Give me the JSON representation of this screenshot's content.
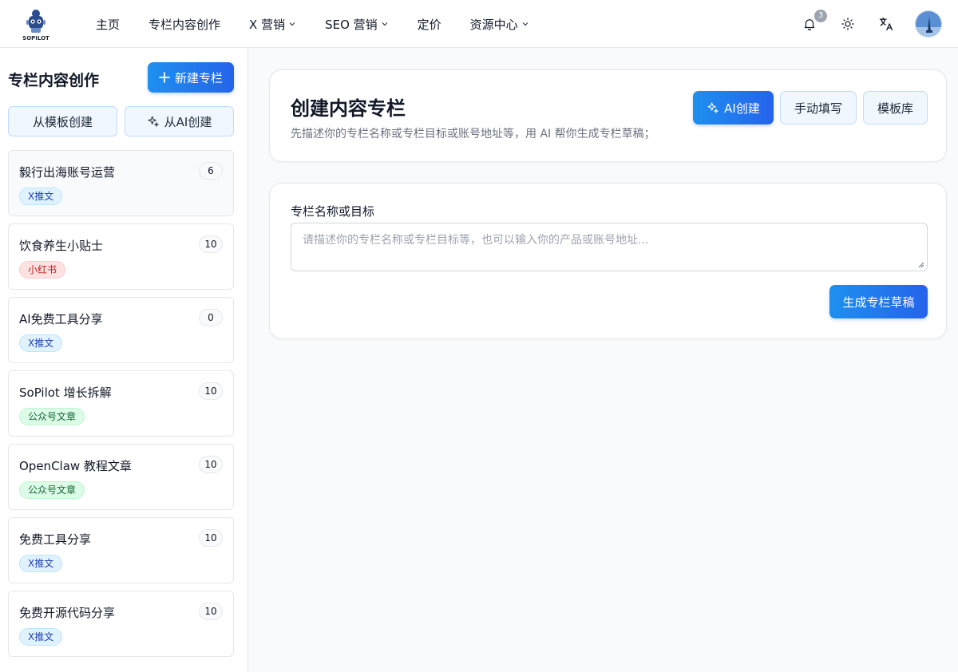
{
  "header": {
    "logo_text": "SOPILOT",
    "nav": [
      {
        "label": "主页"
      },
      {
        "label": "专栏内容创作"
      },
      {
        "label": "X 营销"
      },
      {
        "label": "SEO 营销"
      },
      {
        "label": "定价"
      },
      {
        "label": "资源中心"
      }
    ],
    "notification_count": "3",
    "icons": [
      "bell-icon",
      "sun-icon",
      "translate-icon"
    ]
  },
  "sidebar": {
    "title": "专栏内容创作",
    "new_button": "新建专栏",
    "template_button": "从模板创建",
    "ai_button": "从AI创建",
    "columns": [
      {
        "name": "毅行出海账号运营",
        "count": "6",
        "tag": "X推文"
      },
      {
        "name": "饮食养生小贴士",
        "count": "10",
        "tag": "小红书"
      },
      {
        "name": "AI免费工具分享",
        "count": "0",
        "tag": "X推文"
      },
      {
        "name": "SoPilot 增长拆解",
        "count": "10",
        "tag": "公众号文章"
      },
      {
        "name": "OpenClaw 教程文章",
        "count": "10",
        "tag": "公众号文章"
      },
      {
        "name": "免费工具分享",
        "count": "10",
        "tag": "X推文"
      },
      {
        "name": "免费开源代码分享",
        "count": "10",
        "tag": "X推文"
      }
    ]
  },
  "main": {
    "title": "创建内容专栏",
    "subtitle": "先描述你的专栏名称或专栏目标或账号地址等，用 AI 帮你生成专栏草稿；",
    "ai_create_button": "AI创建",
    "manual_button": "手动填写",
    "template_button": "模板库",
    "field_label": "专栏名称或目标",
    "field_placeholder": "请描述你的专栏名称或专栏目标等，也可以输入你的产品或账号地址...",
    "generate_button": "生成专栏草稿"
  },
  "colors": {
    "primary": "#2563eb",
    "primary_light": "#1e90ef",
    "tag_x": "#e0f2fe",
    "tag_xhs": "#fee2e2",
    "tag_gzh": "#dcfce7"
  }
}
